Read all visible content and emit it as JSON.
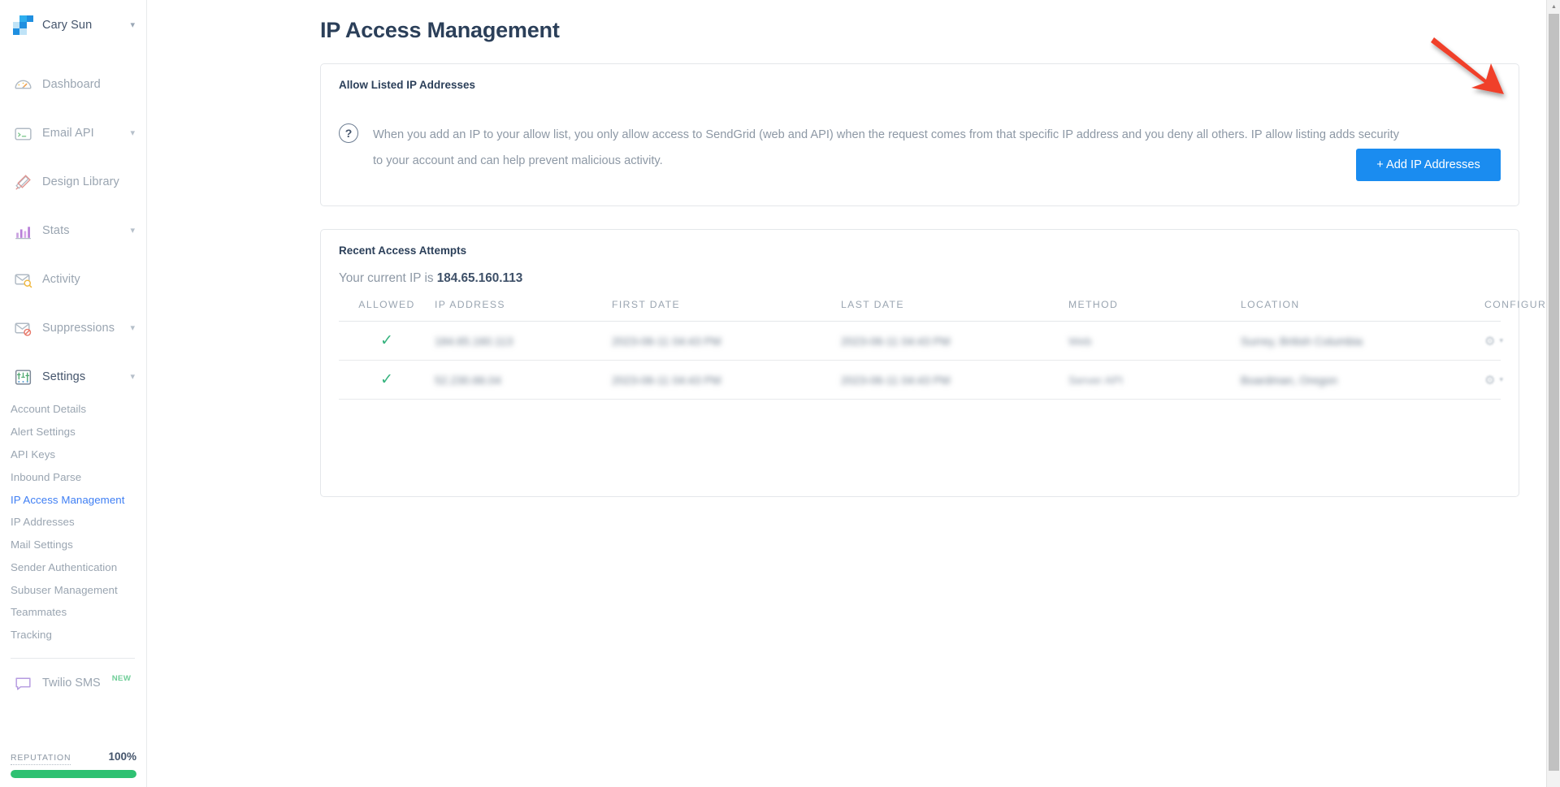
{
  "sidebar": {
    "account": {
      "name": "Cary Sun",
      "caret_icon": "chevron-down-icon"
    },
    "nav": [
      {
        "label": "Dashboard",
        "icon": "speedometer-icon",
        "caret": ""
      },
      {
        "label": "Email API",
        "icon": "terminal-window-icon",
        "caret": "˅"
      },
      {
        "label": "Design Library",
        "icon": "ruler-pencil-icon",
        "caret": ""
      },
      {
        "label": "Stats",
        "icon": "bar-chart-icon",
        "caret": "˅"
      },
      {
        "label": "Activity",
        "icon": "envelope-search-icon",
        "caret": ""
      },
      {
        "label": "Suppressions",
        "icon": "envelope-blocked-icon",
        "caret": "˅"
      },
      {
        "label": "Settings",
        "icon": "sliders-icon",
        "caret": "˅"
      }
    ],
    "settings_sub": [
      {
        "label": "Account Details",
        "selected": false
      },
      {
        "label": "Alert Settings",
        "selected": false
      },
      {
        "label": "API Keys",
        "selected": false
      },
      {
        "label": "Inbound Parse",
        "selected": false
      },
      {
        "label": "IP Access Management",
        "selected": true
      },
      {
        "label": "IP Addresses",
        "selected": false
      },
      {
        "label": "Mail Settings",
        "selected": false
      },
      {
        "label": "Sender Authentication",
        "selected": false
      },
      {
        "label": "Subuser Management",
        "selected": false
      },
      {
        "label": "Teammates",
        "selected": false
      },
      {
        "label": "Tracking",
        "selected": false
      }
    ],
    "twilio": {
      "label": "Twilio SMS",
      "badge": "NEW",
      "icon": "chat-bubble-icon"
    },
    "reputation": {
      "label": "REPUTATION",
      "value": "100%",
      "percent": 100,
      "color": "#2fc172"
    }
  },
  "page": {
    "title": "IP Access Management"
  },
  "allow_card": {
    "heading": "Allow Listed IP Addresses",
    "help_icon": "question-mark-icon",
    "description": "When you add an IP to your allow list, you only allow access to SendGrid (web and API) when the request comes from that specific IP address and you deny all others. IP allow listing adds security to your account and can help prevent malicious activity.",
    "add_button": "+ Add IP Addresses",
    "add_button_color": "#1a8cf0"
  },
  "annotation": {
    "arrow_color": "#f0402c",
    "arrow_icon": "red-arrow-pointing-to-add-button"
  },
  "recent_card": {
    "heading": "Recent Access Attempts",
    "current_ip_prefix": "Your current IP is",
    "current_ip": "184.65.160.113",
    "columns": [
      "ALLOWED",
      "IP ADDRESS",
      "FIRST DATE",
      "LAST DATE",
      "METHOD",
      "LOCATION",
      "CONFIGURE"
    ],
    "rows": [
      {
        "allowed": "✓",
        "ip_address": "184.65.160.113",
        "first_date": "2023-06-11 04:43 PM",
        "last_date": "2023-06-11 04:43 PM",
        "method": "Web",
        "location": "Surrey, British Columbia",
        "configure_icon": "gear-icon"
      },
      {
        "allowed": "✓",
        "ip_address": "52.230.66.04",
        "first_date": "2023-06-11 04:43 PM",
        "last_date": "2023-06-11 04:43 PM",
        "method": "Server API",
        "location": "Boardman, Oregon",
        "configure_icon": "gear-icon"
      }
    ]
  },
  "scrollbar": {
    "up_arrow_icon": "scroll-up-arrow-icon"
  }
}
